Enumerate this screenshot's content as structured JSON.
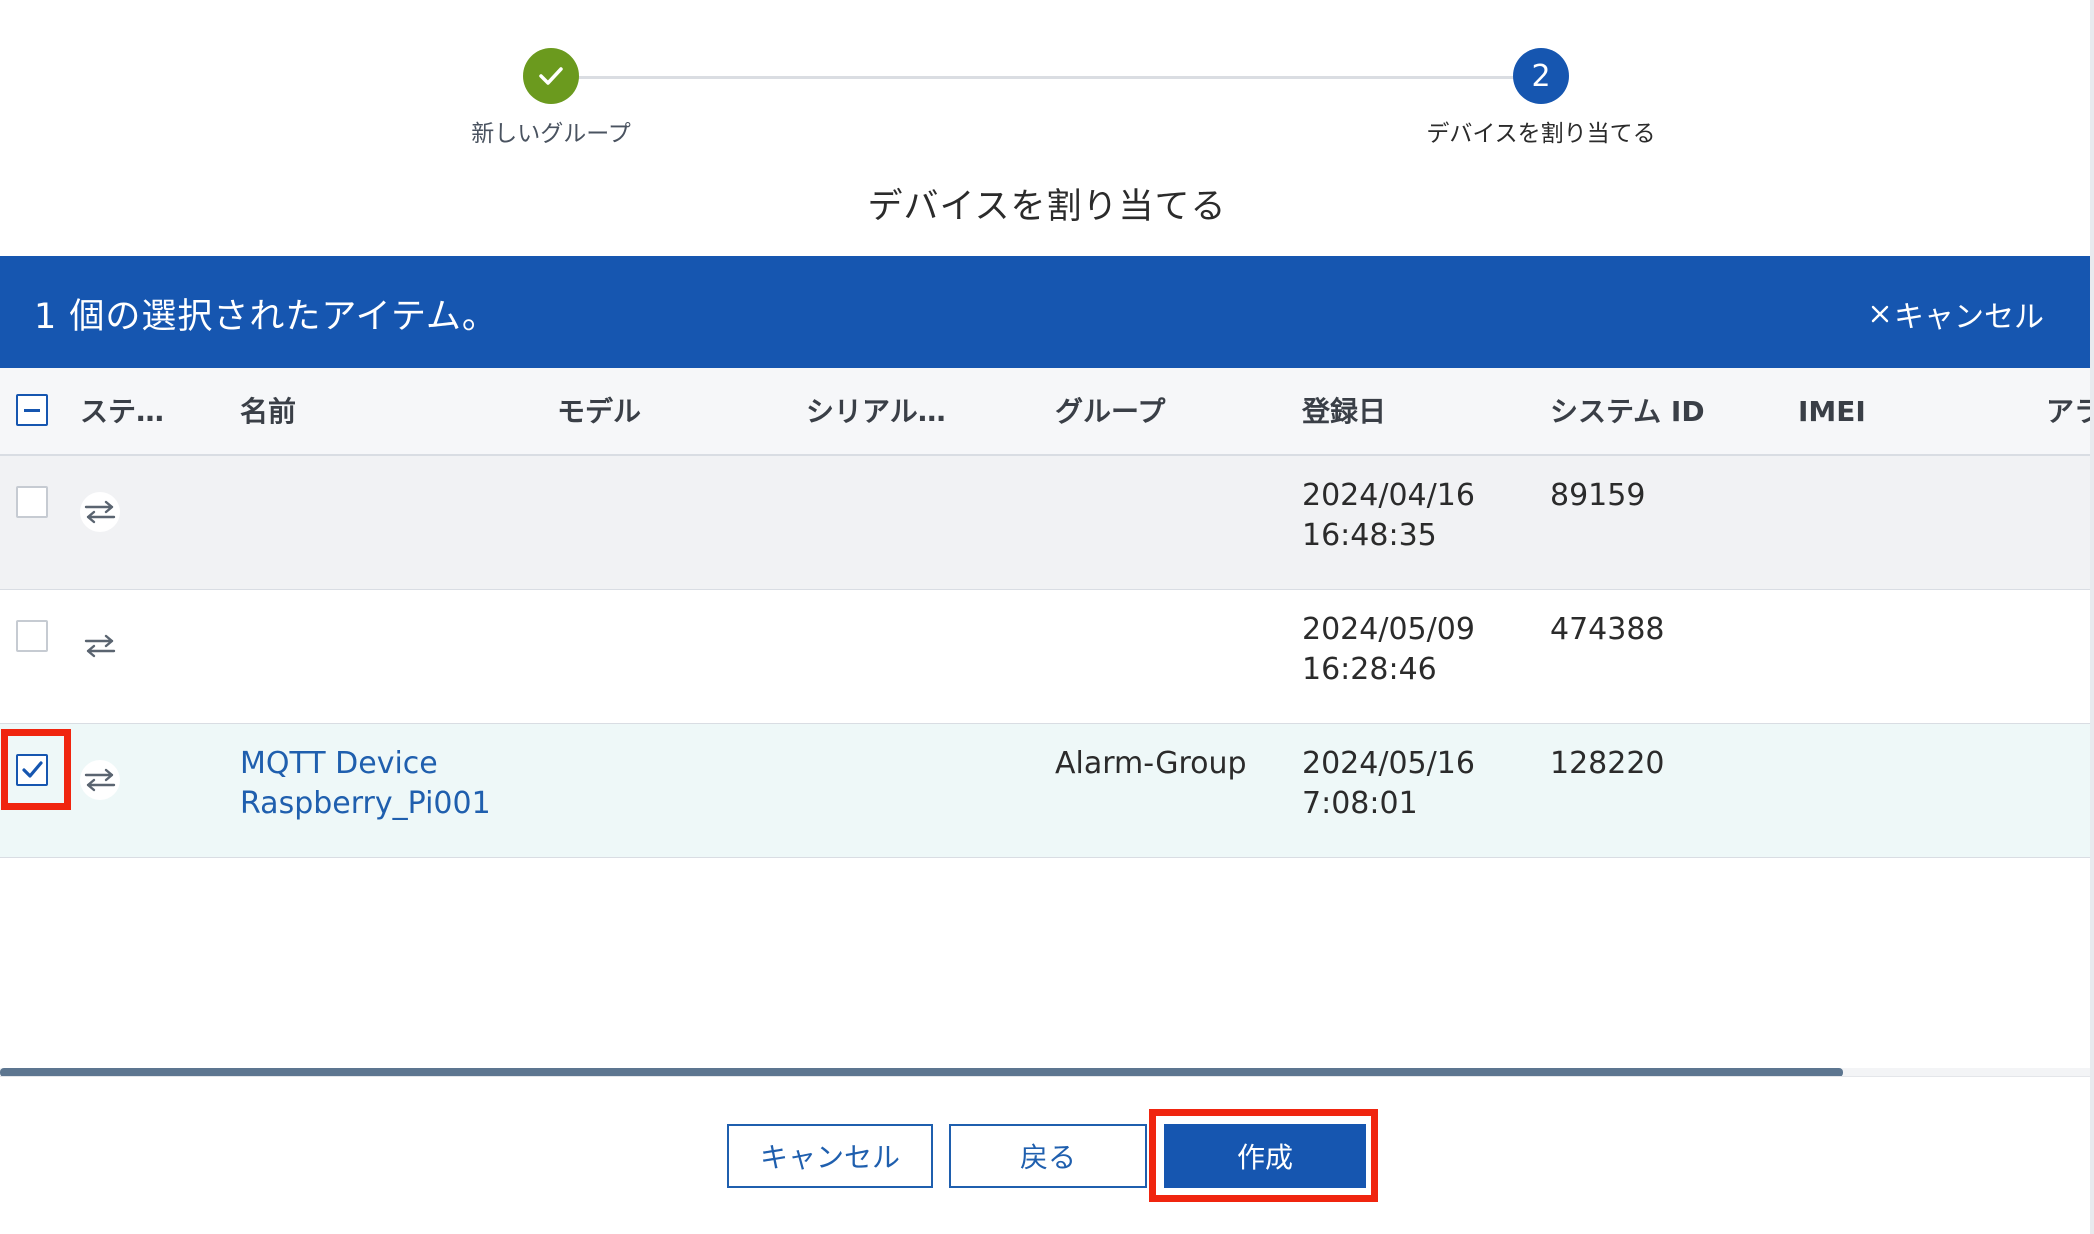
{
  "stepper": {
    "steps": [
      {
        "label": "新しいグループ",
        "state": "complete"
      },
      {
        "label": "デバイスを割り当てる",
        "number": "2",
        "state": "current"
      }
    ],
    "colors": {
      "complete": "#6b9a1e",
      "current": "#1656b0"
    }
  },
  "page_title": "デバイスを割り当てる",
  "selection_bar": {
    "text": "1 個の選択されたアイテム。",
    "cancel_label": "キャンセル",
    "color": "#1656b0"
  },
  "table": {
    "columns": [
      "ステ…",
      "名前",
      "モデル",
      "シリアル…",
      "グループ",
      "登録日",
      "システム ID",
      "IMEI",
      "アラ"
    ],
    "rows": [
      {
        "checked": false,
        "name_line1": "",
        "name_line2": "",
        "group": "",
        "date": "2024/04/16",
        "time": "16:48:35",
        "system_id": "89159"
      },
      {
        "checked": false,
        "name_line1": "",
        "name_line2": "",
        "group": "",
        "date": "2024/05/09",
        "time": "16:28:46",
        "system_id": "474388"
      },
      {
        "checked": true,
        "name_line1": "MQTT Device",
        "name_line2": "Raspberry_Pi001",
        "group": "Alarm-Group",
        "date": "2024/05/16",
        "time": "7:08:01",
        "system_id": "128220"
      }
    ]
  },
  "footer": {
    "cancel_label": "キャンセル",
    "back_label": "戻る",
    "create_label": "作成"
  },
  "highlight_color": "#f0250f"
}
